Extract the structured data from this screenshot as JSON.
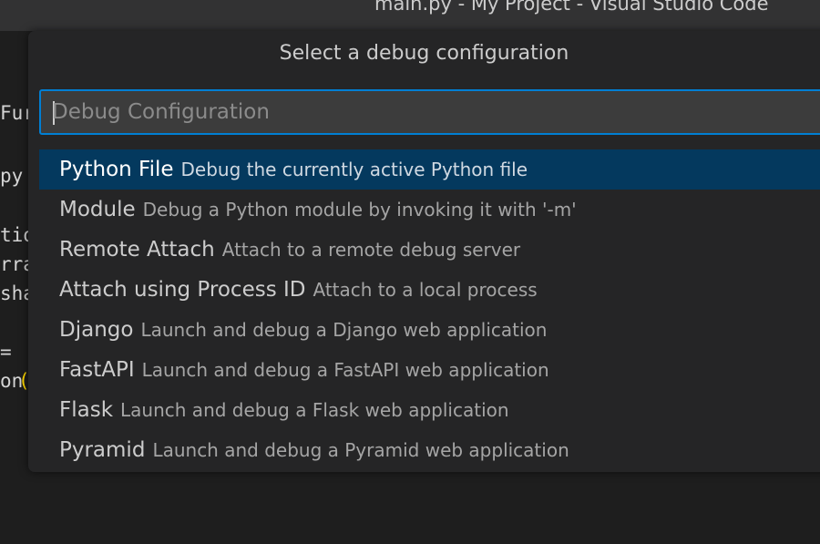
{
  "window": {
    "title": "main.py - My Project - Visual Studio Code"
  },
  "editor": {
    "fragments": [
      "Fur",
      "py",
      "tio",
      "rra",
      "sha",
      "  =",
      "on",
      "("
    ]
  },
  "quick_pick": {
    "title": "Select a debug configuration",
    "input": {
      "placeholder": "Debug Configuration",
      "value": ""
    },
    "selected_index": 0,
    "items": [
      {
        "label": "Python File",
        "description": "Debug the currently active Python file"
      },
      {
        "label": "Module",
        "description": "Debug a Python module by invoking it with '-m'"
      },
      {
        "label": "Remote Attach",
        "description": "Attach to a remote debug server"
      },
      {
        "label": "Attach using Process ID",
        "description": "Attach to a local process"
      },
      {
        "label": "Django",
        "description": "Launch and debug a Django web application"
      },
      {
        "label": "FastAPI",
        "description": "Launch and debug a FastAPI web application"
      },
      {
        "label": "Flask",
        "description": "Launch and debug a Flask web application"
      },
      {
        "label": "Pyramid",
        "description": "Launch and debug a Pyramid web application"
      }
    ]
  },
  "colors": {
    "accent_border": "#007fd4",
    "selection_background": "#04395e",
    "widget_background": "#252526",
    "editor_background": "#1e1e1e"
  }
}
